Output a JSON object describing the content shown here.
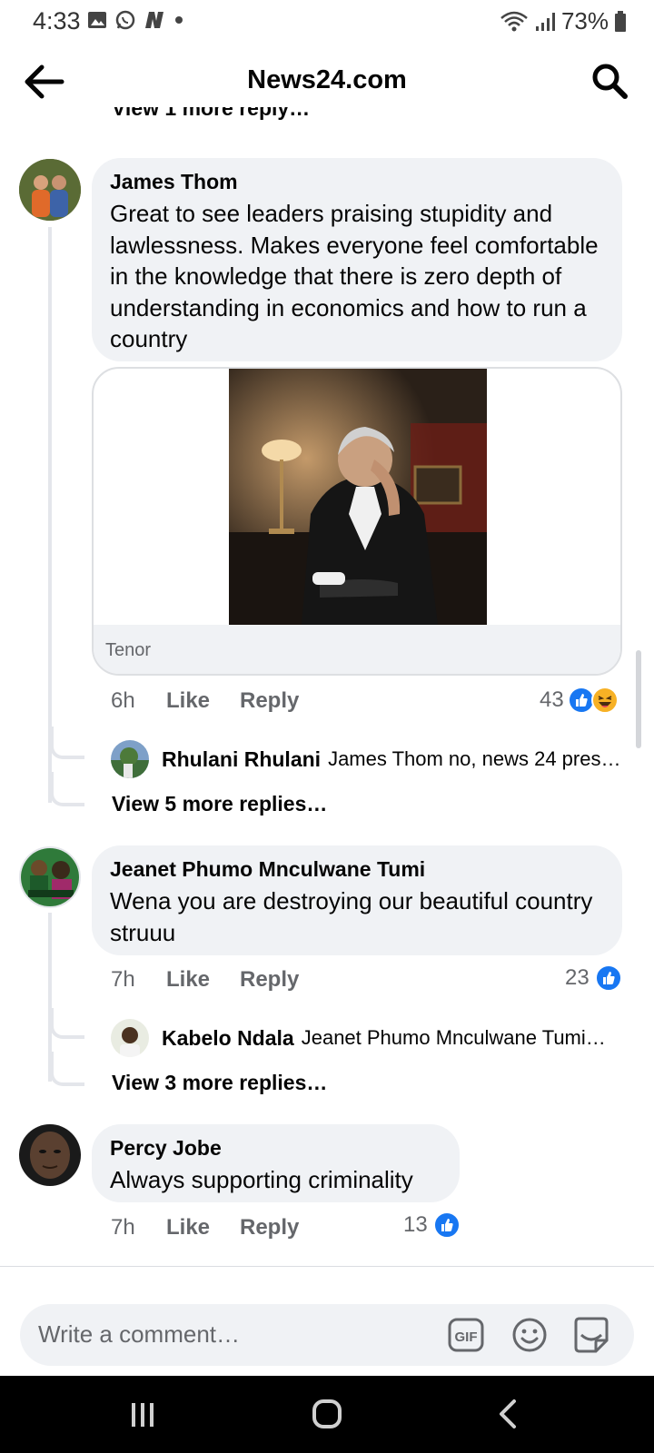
{
  "status_bar": {
    "time": "4:33",
    "battery": "73%"
  },
  "header": {
    "title": "News24.com"
  },
  "partial_top_link": "View 1 more reply…",
  "comments": [
    {
      "author": "James Thom",
      "text": "Great to see leaders praising stupidity and lawlessness. Makes everyone feel comfortable in the knowledge that there is zero depth of understanding in economics and how to run a country",
      "gif_source": "Tenor",
      "time": "6h",
      "like": "Like",
      "reply": "Reply",
      "reaction_count": "43",
      "reactions": [
        "like-icon",
        "haha-icon"
      ],
      "reply_preview": {
        "author": "Rhulani Rhulani",
        "text": "James Thom no, news 24 pres…"
      },
      "more_replies": "View 5 more replies…"
    },
    {
      "author": "Jeanet Phumo Mnculwane Tumi",
      "text": "Wena you are destroying our beautiful country struuu",
      "time": "7h",
      "like": "Like",
      "reply": "Reply",
      "reaction_count": "23",
      "reactions": [
        "like-icon"
      ],
      "reply_preview": {
        "author": "Kabelo Ndala",
        "text": "Jeanet Phumo Mnculwane Tumi…"
      },
      "more_replies": "View 3 more replies…"
    },
    {
      "author": "Percy Jobe",
      "text": "Always supporting criminality",
      "time": "7h",
      "like": "Like",
      "reply": "Reply",
      "reaction_count": "13",
      "reactions": [
        "like-icon"
      ]
    }
  ],
  "composer": {
    "placeholder": "Write a comment…"
  },
  "colors": {
    "like_blue": "#1877f2",
    "haha_yellow": "#f7b125",
    "bubble": "#f0f2f5",
    "meta_gray": "#65676b"
  }
}
